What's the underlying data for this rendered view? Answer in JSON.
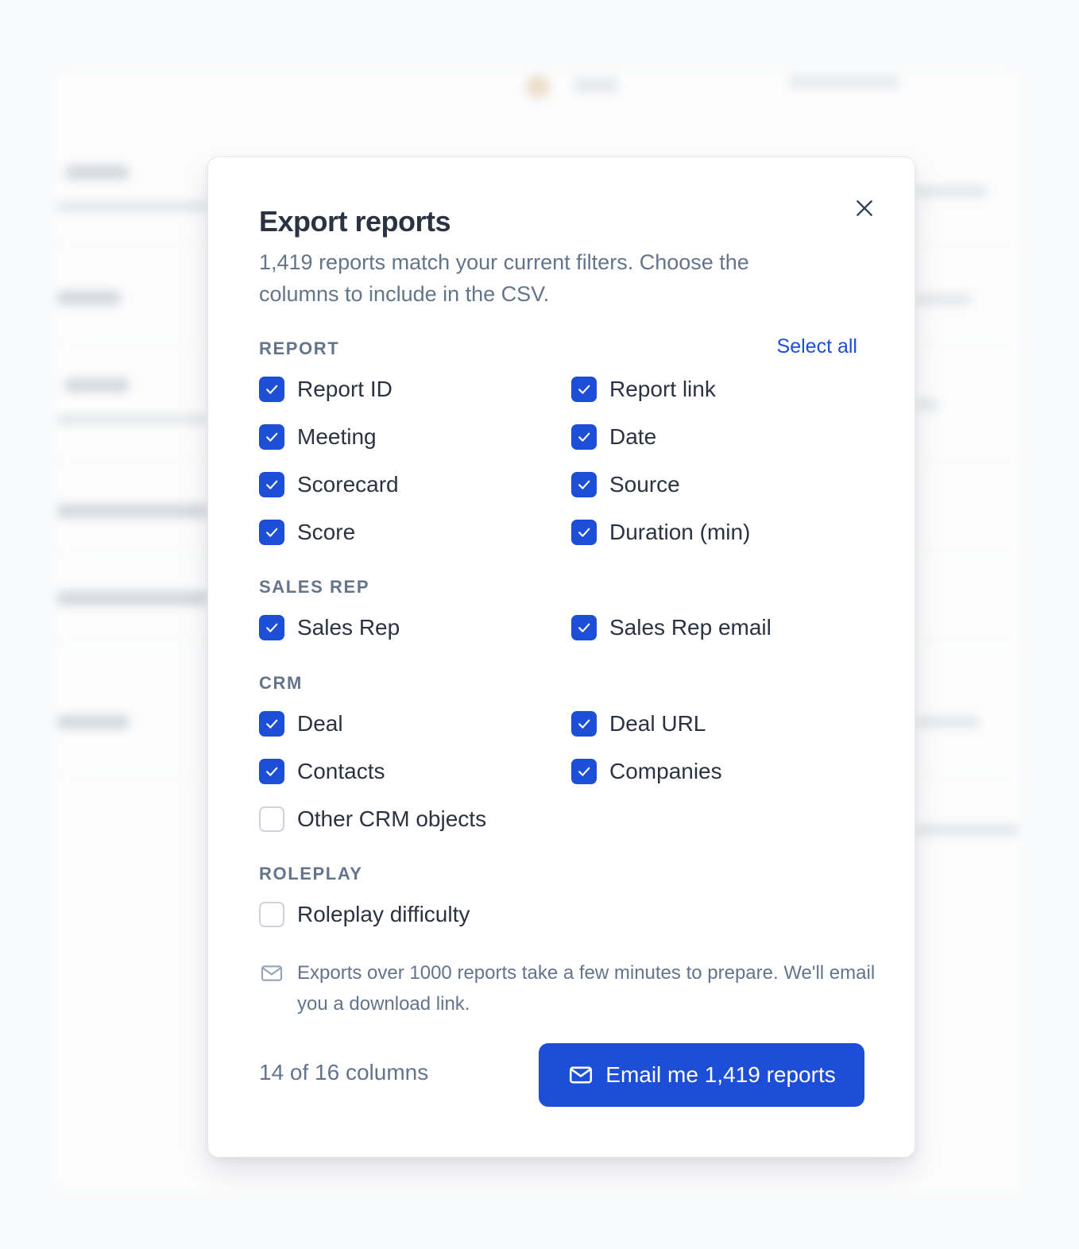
{
  "modal": {
    "title": "Export reports",
    "subtitle": "1,419 reports match your current filters. Choose the columns to include in the CSV.",
    "select_all_label": "Select all",
    "accent_color": "#1d4ed8",
    "sections": {
      "report": {
        "label": "REPORT",
        "options": [
          {
            "label": "Report ID",
            "checked": true
          },
          {
            "label": "Report link",
            "checked": true
          },
          {
            "label": "Meeting",
            "checked": true
          },
          {
            "label": "Date",
            "checked": true
          },
          {
            "label": "Scorecard",
            "checked": true
          },
          {
            "label": "Source",
            "checked": true
          },
          {
            "label": "Score",
            "checked": true
          },
          {
            "label": "Duration (min)",
            "checked": true
          }
        ]
      },
      "sales_rep": {
        "label": "SALES REP",
        "options": [
          {
            "label": "Sales Rep",
            "checked": true
          },
          {
            "label": "Sales Rep email",
            "checked": true
          }
        ]
      },
      "crm": {
        "label": "CRM",
        "options": [
          {
            "label": "Deal",
            "checked": true
          },
          {
            "label": "Deal URL",
            "checked": true
          },
          {
            "label": "Contacts",
            "checked": true
          },
          {
            "label": "Companies",
            "checked": true
          },
          {
            "label": "Other CRM objects",
            "checked": false
          }
        ]
      },
      "roleplay": {
        "label": "ROLEPLAY",
        "options": [
          {
            "label": "Roleplay difficulty",
            "checked": false
          }
        ]
      }
    },
    "note": {
      "icon": "mail-icon",
      "text": "Exports over 1000 reports take a few minutes to prepare. We'll email you a download link."
    },
    "footer": {
      "column_count": "14 of 16 columns",
      "primary_label": "Email me 1,419 reports",
      "primary_icon": "mail-icon"
    },
    "close_icon": "close-icon"
  }
}
